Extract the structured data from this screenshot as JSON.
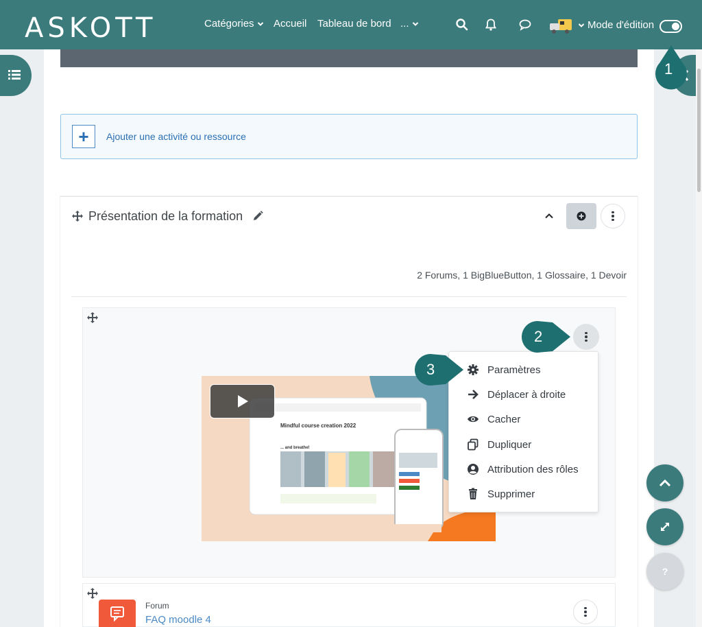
{
  "navbar": {
    "logo": "ASKOTT",
    "links": [
      {
        "label": "Catégories",
        "has_chevron": true
      },
      {
        "label": "Accueil",
        "has_chevron": false
      },
      {
        "label": "Tableau de bord",
        "has_chevron": false
      },
      {
        "label": "...",
        "has_chevron": true
      }
    ],
    "edit_mode_label": "Mode d'édition",
    "edit_mode_on": true
  },
  "add_activity": {
    "label": "Ajouter une activité ou ressource"
  },
  "section": {
    "title": "Présentation de la formation",
    "summary": "2 Forums, 1 BigBlueButton, 1 Glossaire, 1 Devoir"
  },
  "video": {
    "preview_heading": "Mindful course creation 2022",
    "preview_subheading": "... and breathe!"
  },
  "dropdown": {
    "items": [
      {
        "label": "Paramètres",
        "icon": "gear-icon"
      },
      {
        "label": "Déplacer à droite",
        "icon": "arrow-right-icon"
      },
      {
        "label": "Cacher",
        "icon": "eye-icon"
      },
      {
        "label": "Dupliquer",
        "icon": "copy-icon"
      },
      {
        "label": "Attribution des rôles",
        "icon": "user-circle-icon"
      },
      {
        "label": "Supprimer",
        "icon": "trash-icon"
      }
    ]
  },
  "callouts": {
    "one": "1",
    "two": "2",
    "three": "3"
  },
  "forum": {
    "type": "Forum",
    "name": "FAQ moodle 4"
  },
  "colors": {
    "primary": "#3c7b7c",
    "link": "#4a89c6",
    "forum": "#f05a3a",
    "callout": "#1e6f70"
  }
}
